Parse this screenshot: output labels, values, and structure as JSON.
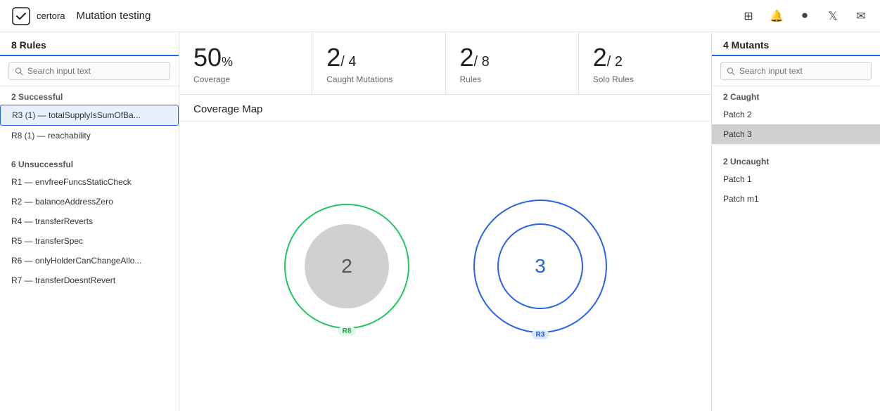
{
  "header": {
    "logo_text": "certora",
    "title": "Mutation testing",
    "icons": [
      "discord-icon",
      "bell-icon",
      "record-icon",
      "twitter-icon",
      "mail-icon"
    ]
  },
  "sidebar": {
    "heading": "8 Rules",
    "search_placeholder": "Search input text",
    "successful_label": "2 Successful",
    "active_item": "R3 (1) — totalSupplyIsSumOfBa...",
    "items_successful": [
      "R3 (1) — totalSupplyIsSumOfBa...",
      "R8 (1) — reachability"
    ],
    "unsuccessful_label": "6 Unsuccessful",
    "items_unsuccessful": [
      "R1 — envfreeFuncsStaticCheck",
      "R2 — balanceAddressZero",
      "R4 — transferReverts",
      "R5 — transferSpec",
      "R6 — onlyHolderCanChangeAllo...",
      "R7 — transferDoesntRevert"
    ]
  },
  "stats": [
    {
      "value": "50",
      "suffix": "%",
      "label": "Coverage",
      "type": "percent"
    },
    {
      "value": "2",
      "slash": "4",
      "label": "Caught Mutations"
    },
    {
      "value": "2",
      "slash": "8",
      "label": "Rules"
    },
    {
      "value": "2",
      "slash": "2",
      "label": "Solo Rules"
    }
  ],
  "coverage_map": {
    "title": "Coverage Map",
    "circle_green": {
      "num": "2",
      "label": "R8",
      "color": "#22c55e"
    },
    "circle_blue": {
      "num": "3",
      "label": "R3",
      "color": "#2563eb"
    }
  },
  "right_panel": {
    "heading": "4 Mutants",
    "search_placeholder": "Search input text",
    "caught_label": "2 Caught",
    "caught_items": [
      "Patch 2",
      "Patch 3"
    ],
    "uncaught_label": "2 Uncaught",
    "uncaught_items": [
      "Patch 1",
      "Patch m1"
    ],
    "selected_item": "Patch 3"
  }
}
